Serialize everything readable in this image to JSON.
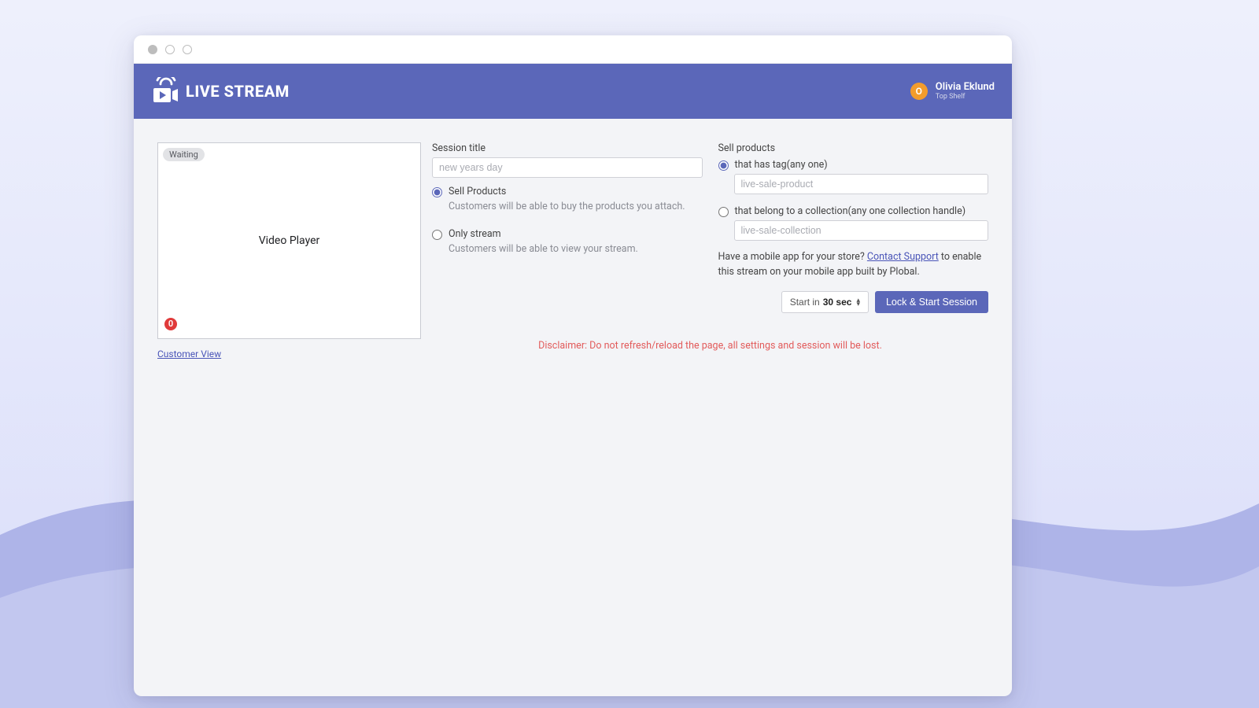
{
  "colors": {
    "accent": "#5b67b9",
    "danger": "#e25b5b",
    "avatar": "#f39c2b"
  },
  "brand": {
    "name": "LIVE STREAM"
  },
  "user": {
    "name": "Olivia Eklund",
    "sub": "Top Shelf",
    "initial": "O"
  },
  "video": {
    "status": "Waiting",
    "placeholder": "Video Player",
    "viewer_count": "0",
    "customer_view": "Customer View"
  },
  "form": {
    "session_title_label": "Session title",
    "session_title_placeholder": "new years day",
    "mode": {
      "sell": {
        "label": "Sell Products",
        "desc": "Customers will be able to buy the products you attach."
      },
      "stream": {
        "label": "Only stream",
        "desc": "Customers will be able to view your stream."
      }
    },
    "sell_products_label": "Sell products",
    "tag": {
      "label": "that has tag(any one)",
      "placeholder": "live-sale-product"
    },
    "collection": {
      "label": "that belong to a collection(any one collection handle)",
      "placeholder": "live-sale-collection"
    },
    "support_note_pre": "Have a mobile app for your store? ",
    "support_link": "Contact Support",
    "support_note_post": " to enable this stream on your mobile app built by Plobal.",
    "start_in_pre": "Start in ",
    "start_in_value": "30 sec",
    "lock_button": "Lock & Start Session"
  },
  "disclaimer": "Disclaimer: Do not refresh/reload the page, all settings and session will be lost."
}
